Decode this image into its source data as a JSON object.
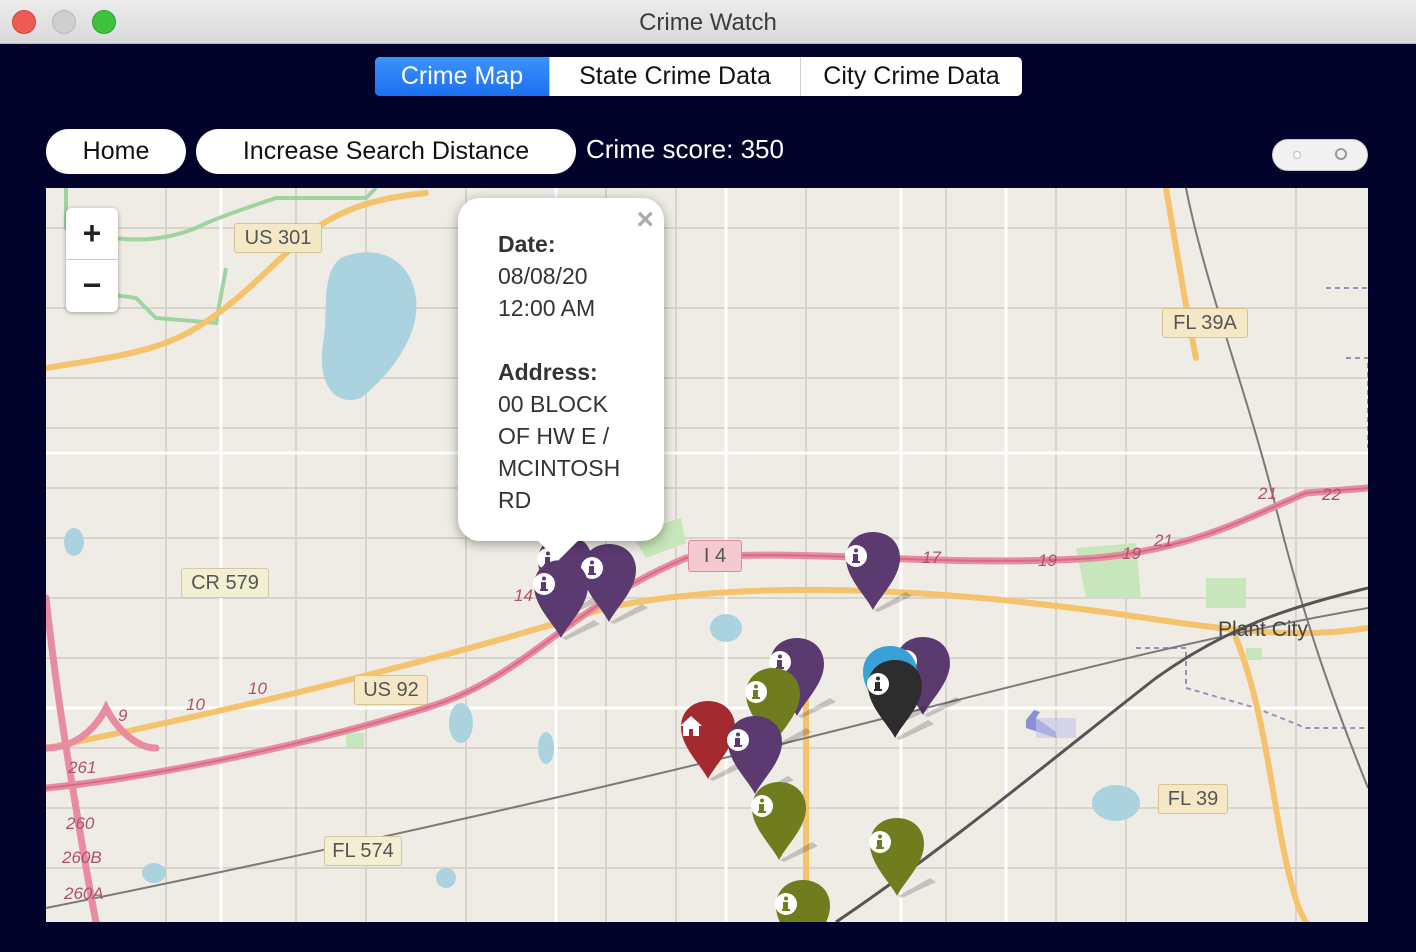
{
  "window": {
    "title": "Crime Watch"
  },
  "tabs": [
    {
      "label": "Crime Map",
      "active": true
    },
    {
      "label": "State Crime Data",
      "active": false
    },
    {
      "label": "City Crime Data",
      "active": false
    }
  ],
  "toolbar": {
    "home_label": "Home",
    "increase_label": "Increase Search Distance",
    "score_text": "Crime score: 350"
  },
  "map": {
    "zoom_in": "+",
    "zoom_out": "−",
    "labels": {
      "us301": "US 301",
      "fl39a": "FL 39A",
      "cr579": "CR 579",
      "i4": "I 4",
      "us92": "US 92",
      "fl574": "FL 574",
      "fl39": "FL 39",
      "plant_city": "Plant City",
      "exit9": "9",
      "exit10a": "10",
      "exit10b": "10",
      "exit14": "14",
      "exit17": "17",
      "exit19a": "19",
      "exit19b": "19",
      "exit21a": "21",
      "exit21b": "21",
      "exit22": "22",
      "exit261": "261",
      "exit260": "260",
      "exit260b": "260B",
      "exit260a": "260A"
    },
    "popup": {
      "date_label": "Date:",
      "date_value": "08/08/20",
      "time_value": "12:00 AM",
      "address_label": "Address:",
      "address_lines": [
        "00 BLOCK",
        "OF HW E /",
        "MCINTOSH",
        "RD"
      ],
      "close": "×"
    },
    "marker_colors": {
      "purple": "#5b3a70",
      "olive": "#6f7d1e",
      "red": "#a32a2f",
      "black": "#2d2d2d",
      "blue": "#3aa0d8"
    }
  }
}
